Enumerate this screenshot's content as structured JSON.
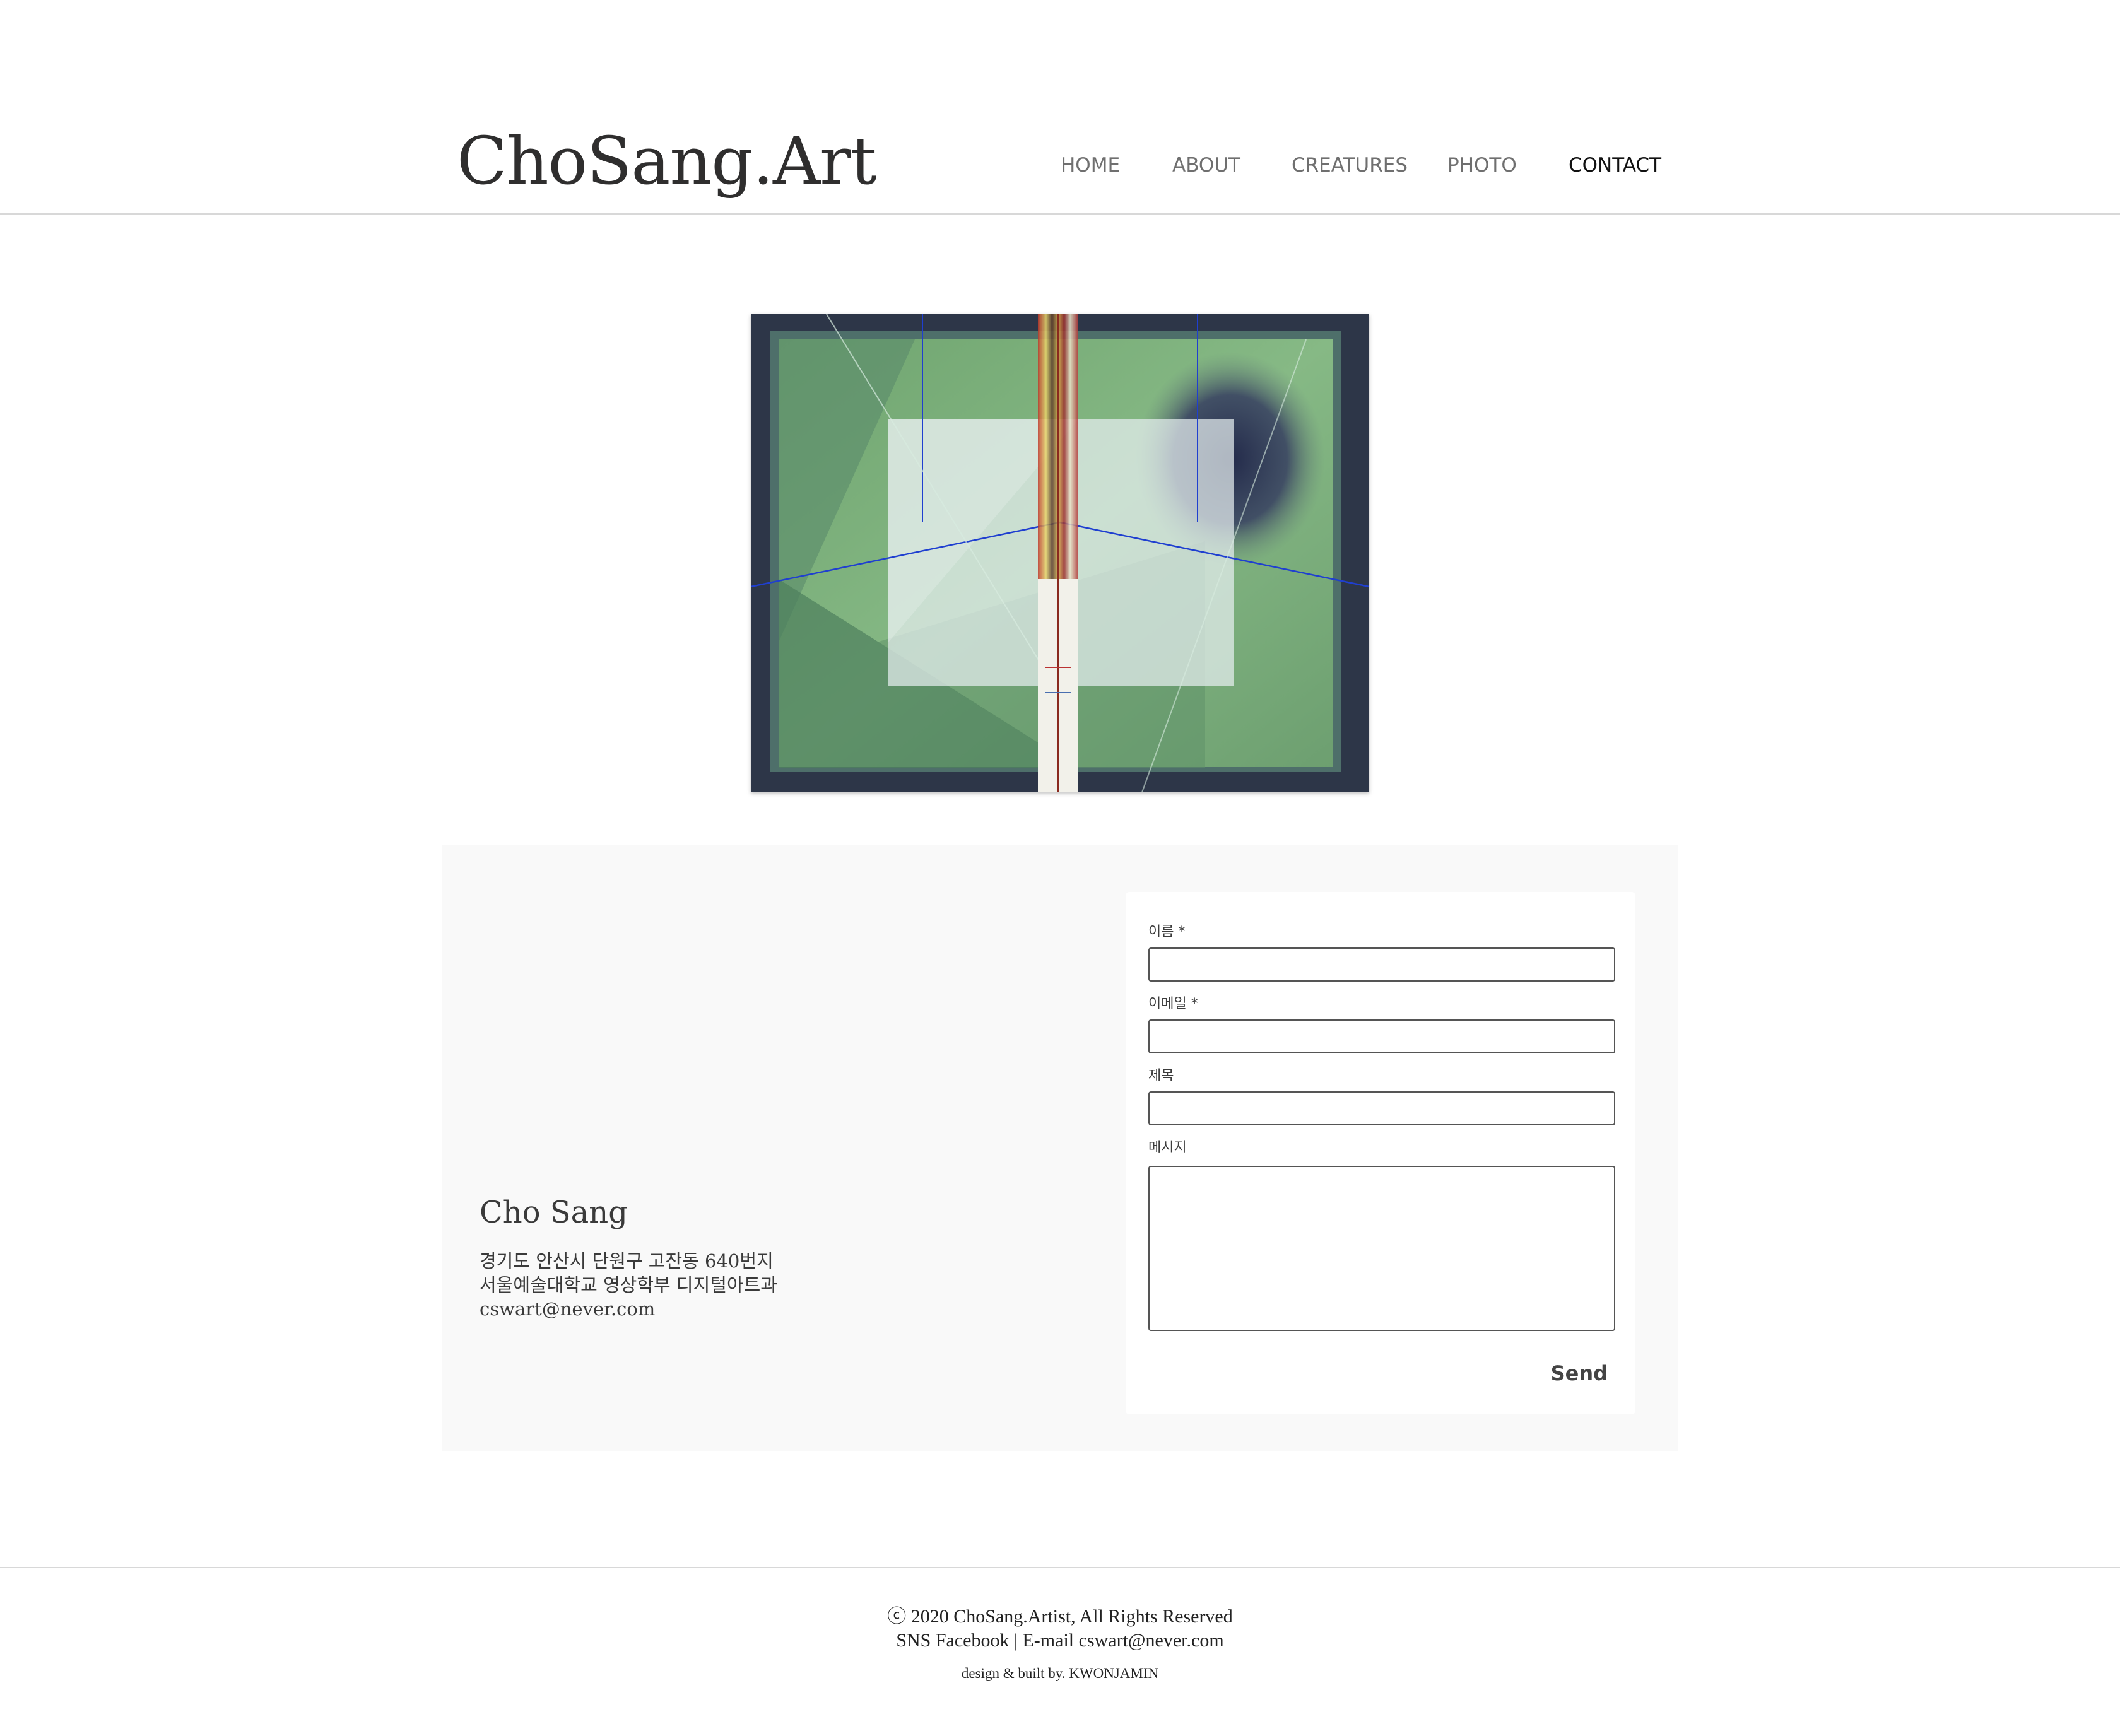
{
  "site": {
    "title": "ChoSang.Art"
  },
  "nav": {
    "items": [
      {
        "label": "HOME"
      },
      {
        "label": "ABOUT"
      },
      {
        "label": "CREATURES"
      },
      {
        "label": "PHOTO"
      },
      {
        "label": "CONTACT",
        "active": true
      }
    ]
  },
  "contact": {
    "name": "Cho Sang",
    "address_line1": "경기도 안산시 단원구 고잔동 640번지",
    "address_line2": "서울예술대학교 영상학부 디지털아트과",
    "email": "cswart@never.com"
  },
  "form": {
    "name_label": "이름 *",
    "email_label": "이메일 *",
    "subject_label": "제목",
    "message_label": "메시지",
    "name_value": "",
    "email_value": "",
    "subject_value": "",
    "message_value": "",
    "send_label": "Send"
  },
  "footer": {
    "copyright": "ⓒ 2020 ChoSang.Artist, All Rights Reserved",
    "links": "SNS Facebook | E-mail cswart@never.com",
    "credit": "design & built by. KWONJAMIN"
  },
  "colors": {
    "text_dark": "#2f2e2e",
    "nav_text": "#6f6f6f",
    "panel_bg": "#f9f9f9",
    "artwork_green": "#7fb07e",
    "artwork_navy": "#2d3648"
  }
}
